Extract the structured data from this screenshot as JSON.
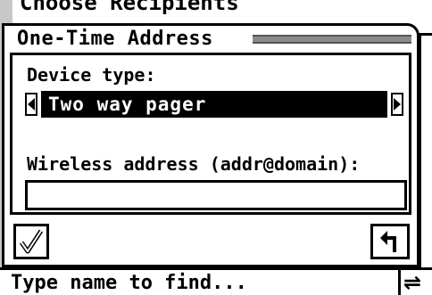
{
  "background": {
    "title": "Choose Recipients",
    "find_placeholder": "Type name to find..."
  },
  "dialog": {
    "title": "One-Time Address",
    "device_type_label": "Device type:",
    "device_type_value": "Two way pager",
    "wireless_label": "Wireless address (addr@domain):",
    "wireless_value": ""
  },
  "icons": {
    "ok": "checkmark-icon",
    "back": "return-arrow-icon",
    "prev": "triangle-left-icon",
    "next": "triangle-right-icon",
    "scroll": "double-arrow-icon"
  },
  "colors": {
    "screen_bg": "#c8c8c8",
    "selection_bg": "#000000",
    "selection_fg": "#ffffff",
    "title_stripe": "#8a8a8a"
  }
}
